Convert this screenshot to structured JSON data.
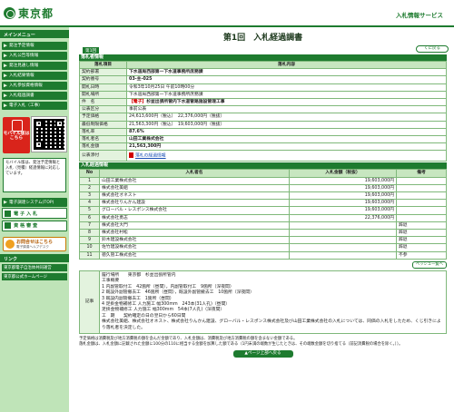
{
  "header": {
    "logo_text": "東京都",
    "service_title": "入札情報サービス"
  },
  "sidebar": {
    "menu_title": "メインメニュー",
    "items": [
      {
        "label": "発注予定情報"
      },
      {
        "label": "入札公告等情報"
      },
      {
        "label": "発注見通し情報"
      },
      {
        "label": "入札結果情報"
      },
      {
        "label": "入札参加資格情報"
      },
      {
        "label": "入札経過調書"
      },
      {
        "label": "電子入札（工事）"
      }
    ],
    "mobile_badge": "モバイル版はこちら",
    "mobile_note": "モバイル版は、発注予定情報と入札（見積）経過情報に対応しています。",
    "system_top": "電子調達システム(TOP)",
    "denshi_nyusatsu": "電 子 入 札",
    "shikaku": "資 格 審 査",
    "inquiry_main": "お問合せはこちら",
    "inquiry_sub": "電子調達ヘルプデスク",
    "links_title": "リンク",
    "links": [
      {
        "label": "東京都電子自治体共同運営"
      },
      {
        "label": "東京都公式ホームページ"
      }
    ]
  },
  "main": {
    "page_title": "第1回　入札経過調書",
    "back_button": "くに戻る",
    "round_tab": "第1回",
    "info_section": "落札者情報",
    "info_header": {
      "item": "落札項目",
      "content": "落札内容"
    },
    "info_rows": [
      {
        "label": "契約部署",
        "value": "下水道局西部第一下水道事務所庶務課"
      },
      {
        "label": "契約番号",
        "value": "03-主-025"
      },
      {
        "label": "開札日時",
        "value": "令和3年10月25日 午前10時00分"
      },
      {
        "label": "開札場所",
        "value": "下水道局西部第一下水道事務所庶務課"
      },
      {
        "label": "件　名",
        "value_prefix": "【電子】",
        "value": "杉並出張所管内下水道管路施設管理工事"
      },
      {
        "label": "公表区分",
        "value": "事前公表"
      },
      {
        "label": "予定価格",
        "value": "24,613,600円（税込）　22,376,000円（税抜）"
      },
      {
        "label": "最低制限価格",
        "value": "21,563,300円（税込）　19,603,000円（税抜）"
      },
      {
        "label": "落札率",
        "value": "87.6%"
      },
      {
        "label": "落札者名",
        "value": "山田工業株式会社"
      },
      {
        "label": "落札金額",
        "value": "21,563,300円"
      },
      {
        "label": "公表添付",
        "value": "落札の経過情報"
      }
    ],
    "bid_section": "入札経過情報",
    "bid_header": {
      "no": "No",
      "name": "入札者名",
      "amount": "入札金額（税抜）",
      "note": "備考"
    },
    "bids": [
      {
        "no": "1",
        "name": "山田工業株式会社",
        "amount": "19,603,000円",
        "note": ""
      },
      {
        "no": "2",
        "name": "株式会社美組",
        "amount": "19,603,000円",
        "note": ""
      },
      {
        "no": "3",
        "name": "株式会社オネスト",
        "amount": "19,603,000円",
        "note": ""
      },
      {
        "no": "4",
        "name": "株式会社りんかん建設",
        "amount": "19,603,000円",
        "note": ""
      },
      {
        "no": "5",
        "name": "グローバル・レスポンス株式会社",
        "amount": "19,603,000円",
        "note": ""
      },
      {
        "no": "6",
        "name": "株式会社勇志",
        "amount": "22,376,000円",
        "note": ""
      },
      {
        "no": "7",
        "name": "株式会社大門",
        "amount": "",
        "note": "辞退"
      },
      {
        "no": "8",
        "name": "株式会社村松",
        "amount": "",
        "note": "辞退"
      },
      {
        "no": "9",
        "name": "鈴木建設株式会社",
        "amount": "",
        "note": "辞退"
      },
      {
        "no": "10",
        "name": "佐竹建設株式会社",
        "amount": "",
        "note": "辞退"
      },
      {
        "no": "11",
        "name": "徳久管工株式会社",
        "amount": "",
        "note": "不参"
      }
    ],
    "more_button": "ペッシュ一覧へ",
    "remarks_label": "記事",
    "remarks_lines": [
      "履行場所　　東京都　杉並出張所管内",
      "工事概要",
      "1 内副管取付工　42箇所（昼間），内副管取付工　9箇所（深夜間）",
      "2 既設外副管撤去工　46箇所（昼間），既設外副管撤去工　10箇所（深夜間）",
      "3 既設内副管撤去工　1箇所（昼間）",
      "4 足掛金物補修工 人力施工 幅300mm　243本(31人孔)（昼間）",
      "足掛金物補修工 人力施工 幅300mm　54本(7人孔)（深夜間）",
      "工　期　　契約確定の日の翌日から60日間",
      "株式会社美組、株式会社オネスト、株式会社りんかん建設、グローバル・レスポンス株式会社及び山田工業株式会社の入札については、同価の入札をしたため、くじ引きにより落札者を決定した。"
    ],
    "footnote_1": "予定価格は消費税及び地方消費税の額を含んだ金額であり、入札金額は、消費税及び地方消費税の額を含まない金額である。",
    "footnote_2": "落札金額は、入札金額に記載された金額に100分の110に相当する金額を加算した額である（1円未満の端数が生じたときは、その端数金額を切り捨てる（前記消費税の場合を除く。））。",
    "top_button": "▲ページ上部へ戻る"
  }
}
